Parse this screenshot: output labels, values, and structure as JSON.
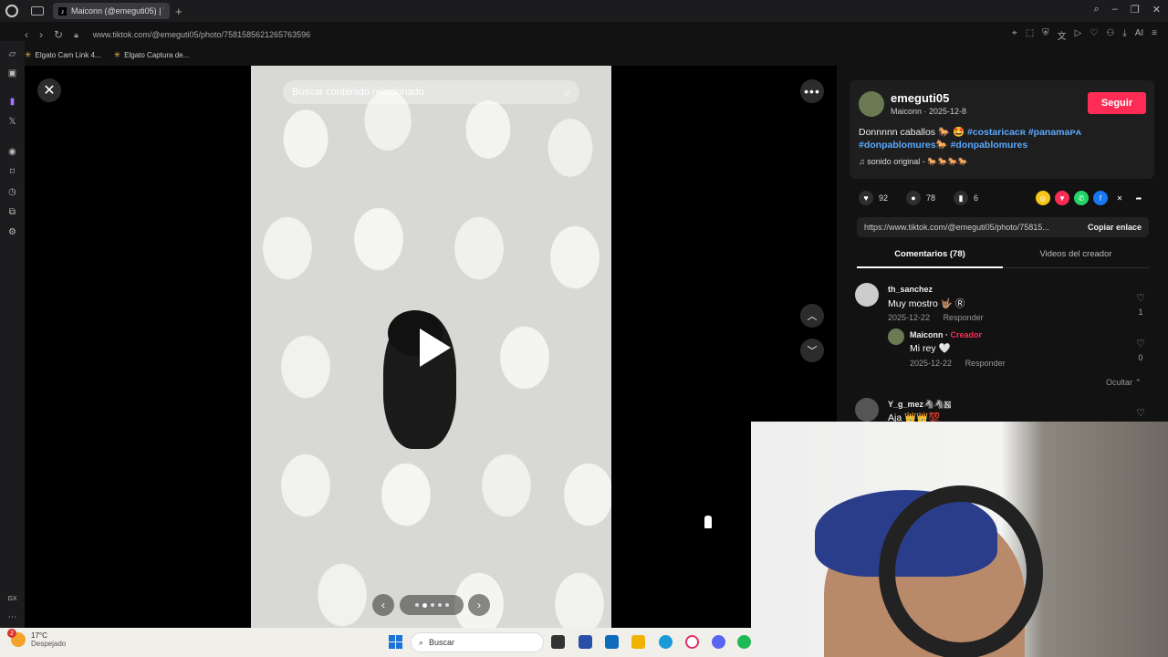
{
  "browser": {
    "tab_title": "Maiconn (@emeguti05) | T",
    "tab_favicon": "tiktok-icon",
    "url": "www.tiktok.com/@emeguti05/photo/7581585621265763596",
    "bookmarks": [
      "Elgato Cam Link 4...",
      "Elgato Captura de..."
    ],
    "sidebar_text": "GX"
  },
  "viewer": {
    "search_placeholder": "Buscar contenido relacionado",
    "slide_count": 5,
    "active_slide": 2
  },
  "post": {
    "author_name": "emeguti05",
    "author_sub": "Maiconn · 2025-12-8",
    "follow_label": "Seguir",
    "caption_text": "Donnnnn caballos 🐎 🤩 ",
    "tags_line1": [
      "#costaricacʀ",
      "#panamaᴘᴀ"
    ],
    "tags_line2": [
      "#donpablomures🐎",
      "#donpablomures"
    ],
    "sound": "♫  sonido original - 🐎🐎🐎🐎",
    "likes": "92",
    "comments": "78",
    "saves": "6",
    "link": "https://www.tiktok.com/@emeguti05/photo/75815...",
    "copy_label": "Copiar enlace",
    "tab_comments": "Comentarios (78)",
    "tab_videos": "Videos del creador"
  },
  "comments": [
    {
      "name": "th_sanchez",
      "text": "Muy mostro 🤟🏽 Ⓡ",
      "date": "2025-12-22",
      "reply": "Responder",
      "likes": "1"
    },
    {
      "name": "Maiconn",
      "creator": "Creador",
      "text": "Mi rey 🤍",
      "date": "2025-12-22",
      "reply": "Responder",
      "likes": "0"
    },
    {
      "name": "Y_g_mez🦓🦓🇳",
      "text": "Aja 👑👑💯"
    }
  ],
  "hide_label": "Ocultar ⌃",
  "taskbar": {
    "weather_badge": "2",
    "temp": "17°C",
    "condition": "Despejado",
    "search_label": "Buscar"
  },
  "colors": {
    "accent": "#fe2c55",
    "link": "#5aa8ff",
    "panel_bg": "#121212"
  }
}
